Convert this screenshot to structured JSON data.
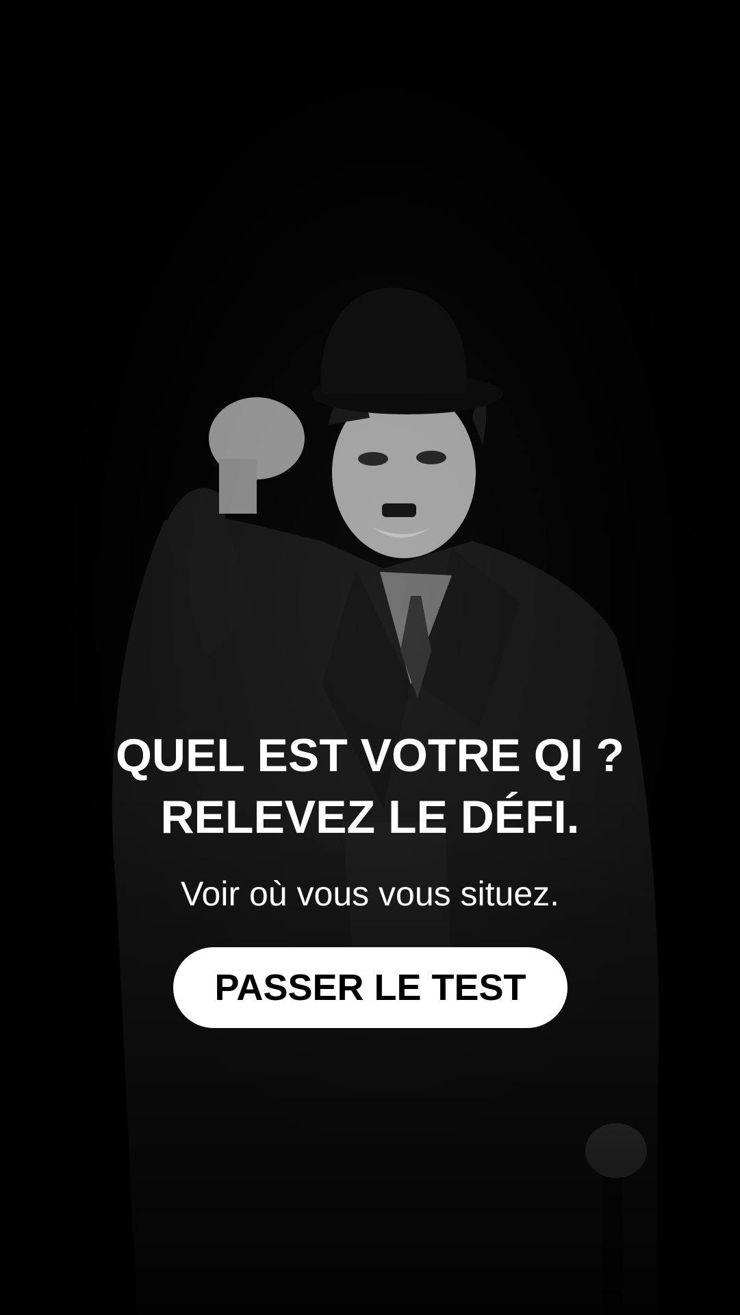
{
  "hero": {
    "image": "man-in-bowler-hat-photo",
    "headline_line1": "QUEL EST VOTRE QI ?",
    "headline_line2": "RELEVEZ LE DÉFI.",
    "subtitle": "Voir où vous vous situez."
  },
  "cta": {
    "label": "PASSER LE TEST"
  },
  "colors": {
    "background": "#000000",
    "text": "#ffffff",
    "button_bg": "#ffffff",
    "button_text": "#000000"
  }
}
